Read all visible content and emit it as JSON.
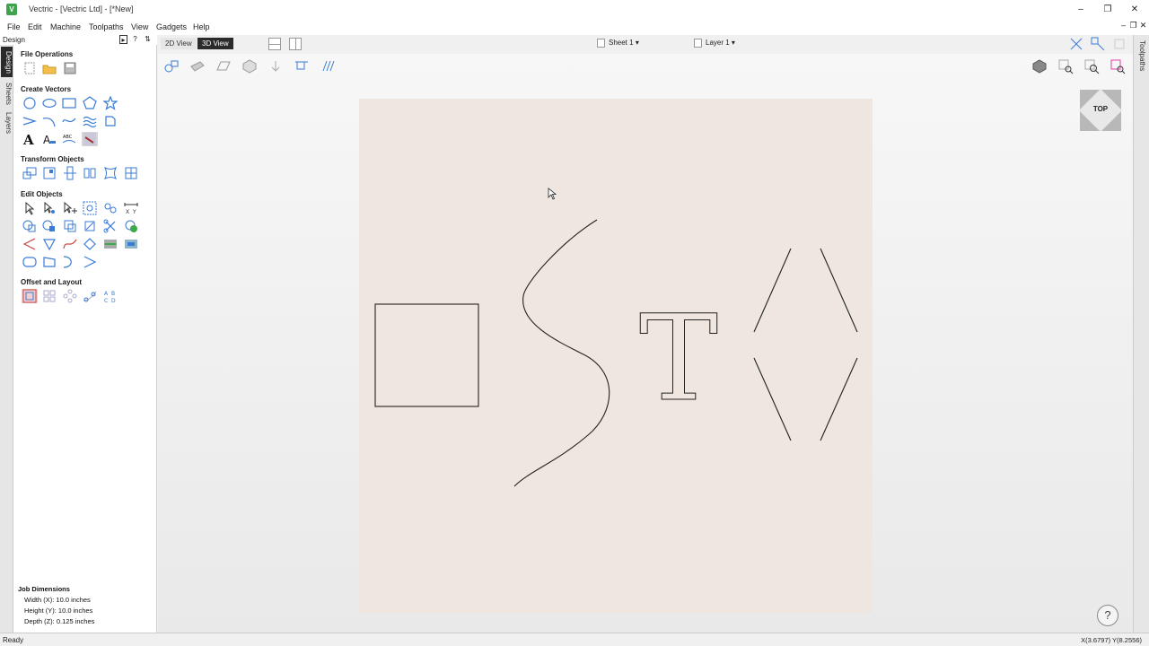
{
  "window": {
    "title": "Vectric - [Vectric Ltd] - [*New]",
    "app_icon": "V"
  },
  "menu": {
    "items": [
      "File",
      "Edit",
      "Machine",
      "Toolpaths",
      "View",
      "Gadgets",
      "Help"
    ]
  },
  "panel": {
    "title": "Design",
    "side_tabs": [
      "Design",
      "Sheets",
      "Layers"
    ],
    "sections": {
      "file_operations": "File Operations",
      "create_vectors": "Create Vectors",
      "transform_objects": "Transform Objects",
      "edit_objects": "Edit Objects",
      "offset_layout": "Offset and Layout"
    },
    "job_dimensions": {
      "heading": "Job Dimensions",
      "width": "Width  (X): 10.0 inches",
      "height": "Height (Y): 10.0 inches",
      "depth": "Depth  (Z): 0.125 inches"
    }
  },
  "view": {
    "tab_2d": "2D View",
    "tab_3d": "3D View",
    "sheet": "Sheet 1",
    "layer": "Layer 1",
    "cube_label": "TOP",
    "text_vector": "T"
  },
  "right_tabs": [
    "Toolpaths"
  ],
  "status": {
    "text": "Ready",
    "coords": "X(3.6797) Y(8.2556)"
  },
  "colors": {
    "accent": "#2b2b2b",
    "tool_blue": "#3a7bd5",
    "wood": "#eee6df"
  }
}
